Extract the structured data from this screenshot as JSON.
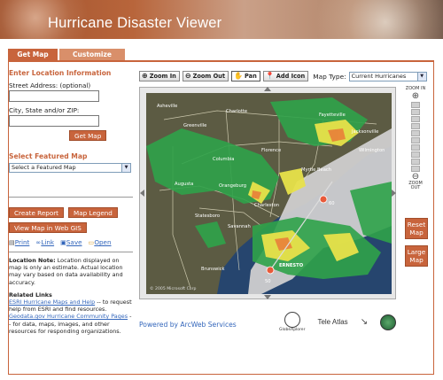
{
  "header": {
    "title": "Hurricane Disaster Viewer"
  },
  "tabs": [
    {
      "label": "Get Map"
    },
    {
      "label": "Customize Map"
    }
  ],
  "location": {
    "heading": "Enter Location Information",
    "street_label": "Street Address: (optional)",
    "city_label": "City, State and/or ZIP:",
    "get_map_label": "Get Map"
  },
  "featured": {
    "heading": "Select Featured Map",
    "select_value": "Select a Featured Map"
  },
  "actions": {
    "create_report": "Create Report",
    "map_legend": "Map Legend",
    "view_web_gis": "View Map in Web GIS",
    "print": "Print",
    "link": "Link",
    "save": "Save",
    "open": "Open"
  },
  "notes": {
    "location_note_title": "Location Note:",
    "location_note_text": "Location displayed on map is only an estimate. Actual location may vary based on data availability and accuracy.",
    "related_title": "Related Links",
    "link1": "ESRI Hurricane Maps and Help",
    "link1_text": "-- to request help from ESRI and find resources.",
    "link2": "Geodata.gov Hurricane Community Pages",
    "link2_text": "-- for data, maps, images, and other resources for responding organizations."
  },
  "toolbar": {
    "zoom_in": "Zoom In",
    "zoom_out": "Zoom Out",
    "pan": "Pan",
    "add_icon": "Add Icon",
    "map_type_label": "Map Type:",
    "map_type_value": "Current Hurricanes"
  },
  "zoom": {
    "in_label": "ZOOM IN",
    "out_label": "ZOOM OUT"
  },
  "side_buttons": {
    "reset": "Reset Map",
    "large": "Large Map"
  },
  "map_labels": {
    "cities": [
      "Asheville",
      "Charlotte",
      "Fayetteville",
      "Greenville",
      "Columbia",
      "Florence",
      "Wilmington",
      "Jacksonville",
      "Augusta",
      "Orangeburg",
      "Savannah",
      "Myrtle Beach",
      "Charleston",
      "Statesboro",
      "Brunswick"
    ],
    "storm_name": "ERNESTO",
    "storm_speeds": [
      "60",
      "50"
    ],
    "copyright": "© 2005 Microsoft Corp"
  },
  "footer": {
    "powered_by": "Powered by ArcWeb Services",
    "logo1": "GlobeXplorer",
    "logo2": "Tele Atlas"
  },
  "colors": {
    "accent": "#c8643c",
    "link": "#3366bb"
  }
}
